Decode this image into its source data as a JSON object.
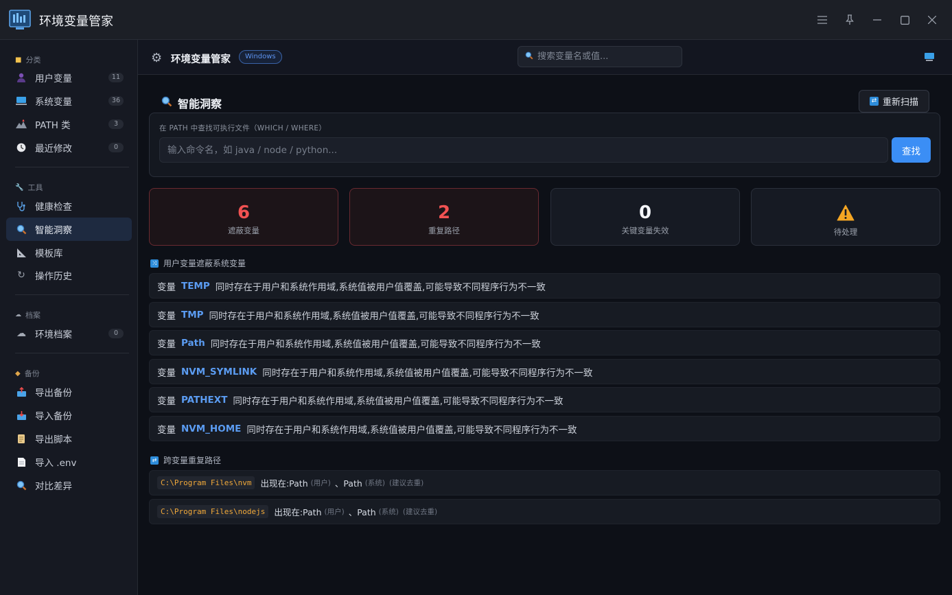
{
  "app": {
    "title": "环境变量管家"
  },
  "sidebar": {
    "sections": [
      {
        "label": "分类",
        "icon": "folder-icon",
        "items": [
          {
            "label": "用户变量",
            "icon": "user-icon",
            "count": "11"
          },
          {
            "label": "系统变量",
            "icon": "computer-icon",
            "count": "36"
          },
          {
            "label": "PATH 类",
            "icon": "path-icon",
            "count": "3"
          },
          {
            "label": "最近修改",
            "icon": "clock-icon",
            "count": "0"
          }
        ]
      },
      {
        "label": "工具",
        "icon": "wrench-icon",
        "items": [
          {
            "label": "健康检查",
            "icon": "stethoscope-icon"
          },
          {
            "label": "智能洞察",
            "icon": "magnifier-icon",
            "active": true
          },
          {
            "label": "模板库",
            "icon": "ruler-icon"
          },
          {
            "label": "操作历史",
            "icon": "history-icon"
          }
        ]
      },
      {
        "label": "档案",
        "icon": "cloud-icon",
        "items": [
          {
            "label": "环境档案",
            "icon": "cloud-icon",
            "count": "0"
          }
        ]
      },
      {
        "label": "备份",
        "icon": "box-icon",
        "items": [
          {
            "label": "导出备份",
            "icon": "outbox-icon"
          },
          {
            "label": "导入备份",
            "icon": "inbox-icon"
          },
          {
            "label": "导出脚本",
            "icon": "scroll-icon"
          },
          {
            "label": "导入 .env",
            "icon": "document-icon"
          },
          {
            "label": "对比差异",
            "icon": "magnifier-icon"
          }
        ]
      }
    ]
  },
  "header": {
    "title": "环境变量管家",
    "badge": "Windows",
    "search_placeholder": "搜索变量名或值..."
  },
  "page": {
    "title": "智能洞察",
    "rescan_label": "重新扫描",
    "finder": {
      "label": "在 PATH 中查找可执行文件（WHICH / WHERE）",
      "placeholder": "输入命令名，如 java / node / python...",
      "button": "查找"
    },
    "stats": [
      {
        "value": "6",
        "label": "遮蔽变量",
        "tone": "danger"
      },
      {
        "value": "2",
        "label": "重复路径",
        "tone": "danger"
      },
      {
        "value": "0",
        "label": "关键变量失效",
        "tone": "normal"
      },
      {
        "value": "",
        "label": "待处理",
        "tone": "warning",
        "icon": "warning-icon"
      }
    ],
    "shadow_group": {
      "title": "用户变量遮蔽系统变量",
      "prefix": "变量",
      "rows": [
        {
          "name": "TEMP",
          "message": "同时存在于用户和系统作用域,系统值被用户值覆盖,可能导致不同程序行为不一致"
        },
        {
          "name": "TMP",
          "message": "同时存在于用户和系统作用域,系统值被用户值覆盖,可能导致不同程序行为不一致"
        },
        {
          "name": "Path",
          "message": "同时存在于用户和系统作用域,系统值被用户值覆盖,可能导致不同程序行为不一致"
        },
        {
          "name": "NVM_SYMLINK",
          "message": "同时存在于用户和系统作用域,系统值被用户值覆盖,可能导致不同程序行为不一致"
        },
        {
          "name": "PATHEXT",
          "message": "同时存在于用户和系统作用域,系统值被用户值覆盖,可能导致不同程序行为不一致"
        },
        {
          "name": "NVM_HOME",
          "message": "同时存在于用户和系统作用域,系统值被用户值覆盖,可能导致不同程序行为不一致"
        }
      ]
    },
    "dup_group": {
      "title": "跨变量重复路径",
      "rows": [
        {
          "path": "C:\\Program Files\\nvm",
          "appears": "出现在:Path",
          "tag1": "(用户)",
          "sep": "、Path",
          "tag2": "(系统)",
          "tag3": "(建议去重)"
        },
        {
          "path": "C:\\Program Files\\nodejs",
          "appears": "出现在:Path",
          "tag1": "(用户)",
          "sep": "、Path",
          "tag2": "(系统)",
          "tag3": "(建议去重)"
        }
      ]
    }
  },
  "colors": {
    "accent": "#3b8ef5",
    "danger": "#f05252",
    "path_text": "#f1a93a",
    "var_name": "#5b9cf2"
  }
}
